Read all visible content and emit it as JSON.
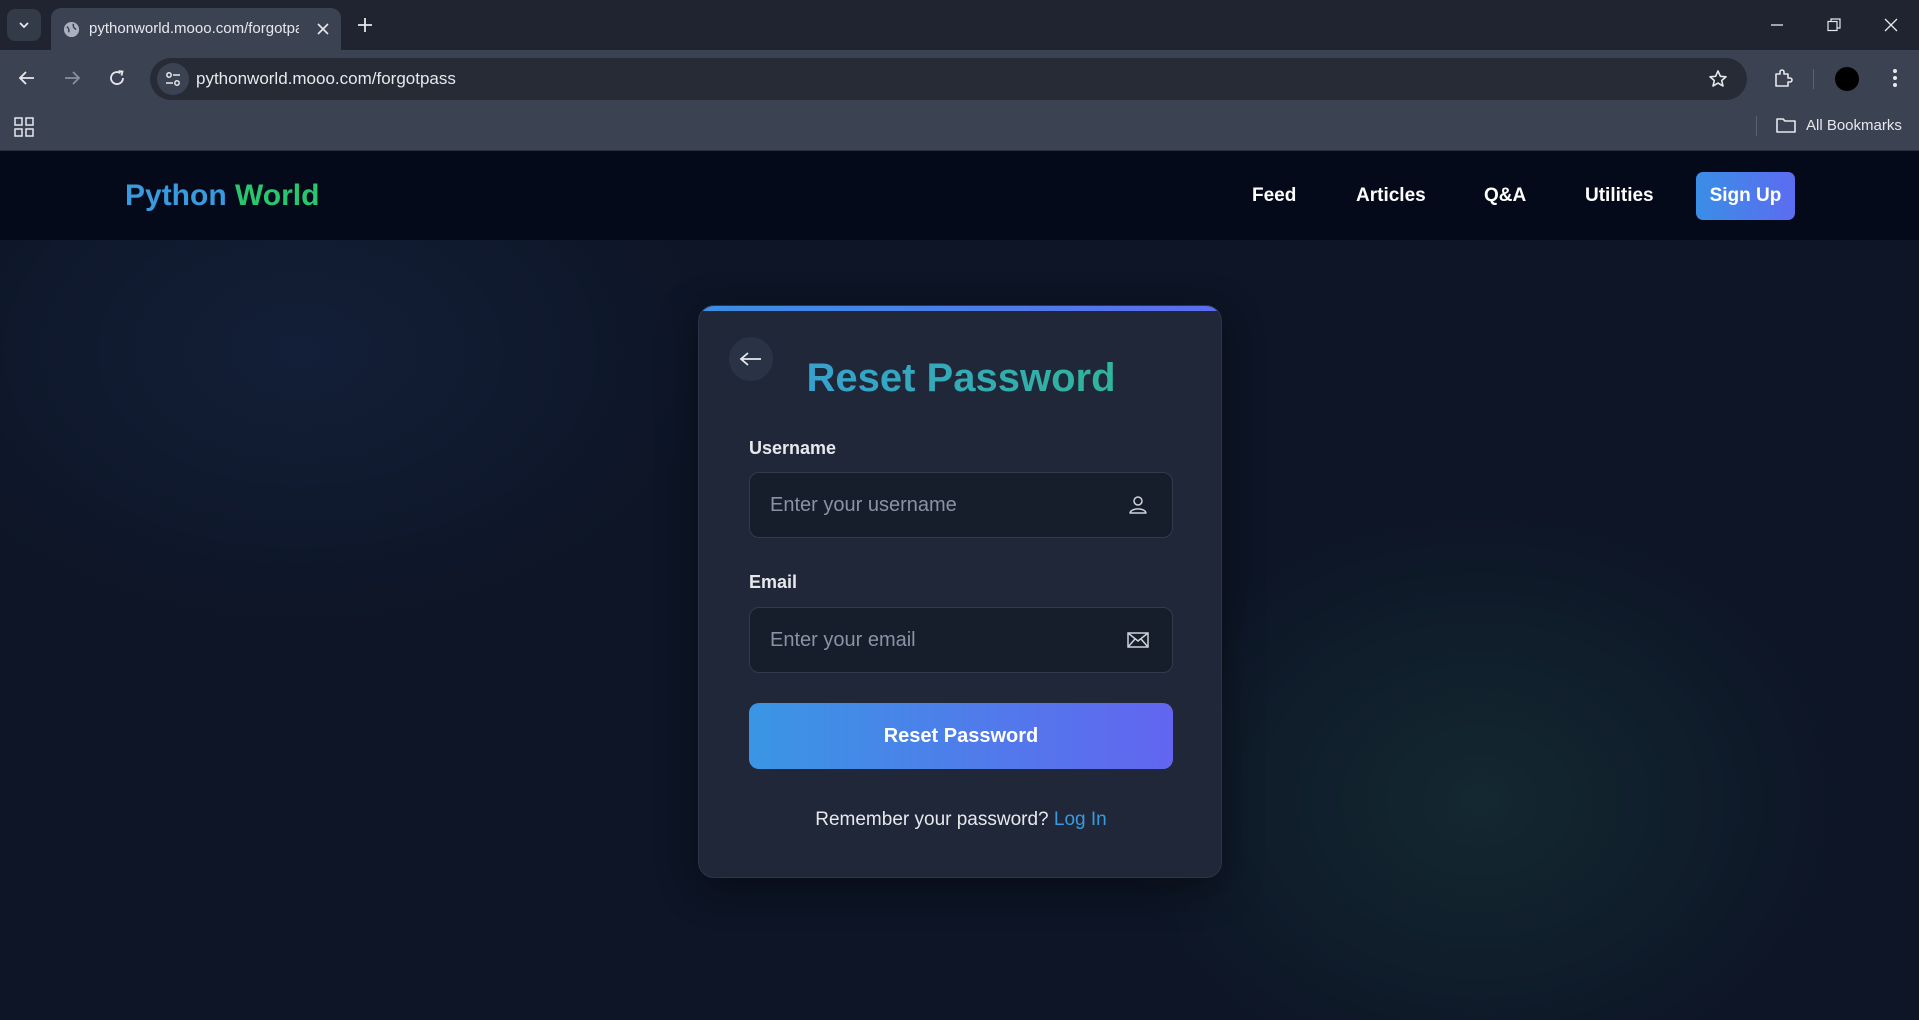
{
  "browser": {
    "tab_title": "pythonworld.mooo.com/forgotpass",
    "url": "pythonworld.mooo.com/forgotpass",
    "bookmarks_label": "All Bookmarks"
  },
  "site": {
    "logo_part1": "Python",
    "logo_part2": "World",
    "nav": [
      "Feed",
      "Articles",
      "Q&A",
      "Utilities"
    ],
    "signup_label": "Sign Up"
  },
  "form": {
    "title": "Reset Password",
    "username_label": "Username",
    "username_placeholder": "Enter your username",
    "email_label": "Email",
    "email_placeholder": "Enter your email",
    "submit_label": "Reset Password",
    "remember_text": "Remember your password?",
    "login_label": "Log In"
  },
  "colors": {
    "accent_blue": "#3a9ae0",
    "accent_green": "#28c76f",
    "button_gradient_end": "#6265f0"
  }
}
